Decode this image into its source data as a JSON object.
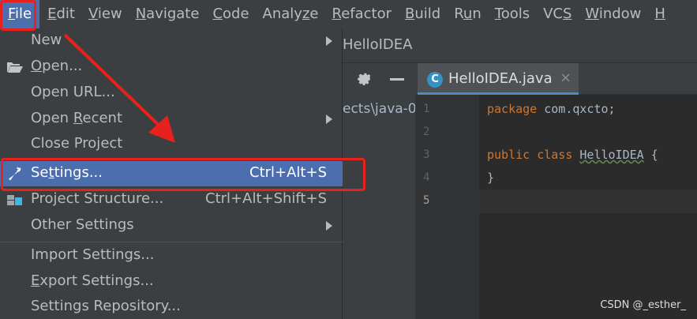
{
  "menubar": {
    "items": [
      {
        "pre": "",
        "u": "F",
        "post": "ile"
      },
      {
        "pre": "",
        "u": "E",
        "post": "dit"
      },
      {
        "pre": "",
        "u": "V",
        "post": "iew"
      },
      {
        "pre": "",
        "u": "N",
        "post": "avigate"
      },
      {
        "pre": "",
        "u": "C",
        "post": "ode"
      },
      {
        "pre": "Analy",
        "u": "z",
        "post": "e"
      },
      {
        "pre": "",
        "u": "R",
        "post": "efactor"
      },
      {
        "pre": "",
        "u": "B",
        "post": "uild"
      },
      {
        "pre": "R",
        "u": "u",
        "post": "n"
      },
      {
        "pre": "",
        "u": "T",
        "post": "ools"
      },
      {
        "pre": "VC",
        "u": "S",
        "post": ""
      },
      {
        "pre": "",
        "u": "W",
        "post": "indow"
      },
      {
        "pre": "",
        "u": "H",
        "post": ""
      }
    ]
  },
  "file_menu": {
    "items": [
      {
        "pre": "New",
        "u": "",
        "post": "",
        "shortcut": "",
        "submenu": true
      },
      {
        "pre": "",
        "u": "O",
        "post": "pen...",
        "shortcut": "",
        "submenu": false,
        "icon": "folder-open-icon"
      },
      {
        "pre": "Open URL...",
        "u": "",
        "post": "",
        "shortcut": "",
        "submenu": false
      },
      {
        "pre": "Open ",
        "u": "R",
        "post": "ecent",
        "shortcut": "",
        "submenu": true
      },
      {
        "pre": "Close Project",
        "u": "",
        "post": "",
        "shortcut": "",
        "submenu": false
      },
      {
        "pre": "Se",
        "u": "t",
        "post": "tings...",
        "shortcut": "Ctrl+Alt+S",
        "submenu": false,
        "icon": "wrench-icon"
      },
      {
        "pre": "Project Structure...",
        "u": "",
        "post": "",
        "shortcut": "Ctrl+Alt+Shift+S",
        "submenu": false,
        "icon": "project-structure-icon"
      },
      {
        "pre": "Other Settings",
        "u": "",
        "post": "",
        "shortcut": "",
        "submenu": true
      },
      {
        "pre": "Import Settings...",
        "u": "",
        "post": "",
        "shortcut": "",
        "submenu": false
      },
      {
        "pre": "",
        "u": "E",
        "post": "xport Settings...",
        "shortcut": "",
        "submenu": false
      },
      {
        "pre": "Settings Repository...",
        "u": "",
        "post": "",
        "shortcut": "",
        "submenu": false
      }
    ],
    "highlighted": "Settings..."
  },
  "navbar": {
    "project_title": "HelloIDEA"
  },
  "project_panel": {
    "path_fragment": "ects\\java-0"
  },
  "editor": {
    "tab_label": "HelloIDEA.java",
    "tab_icon_letter": "C",
    "tab_close": "×",
    "line_numbers": [
      "1",
      "2",
      "3",
      "4",
      "5"
    ],
    "lines": {
      "l1_kw": "package",
      "l1_rest": " com.qxcto;",
      "l3_kw": "public class",
      "l3_name": "HelloIDEA",
      "l3_rest": " {",
      "l4": "}"
    }
  },
  "watermark": "CSDN @_esther_",
  "colors": {
    "menubar_bg": "#3c3f41",
    "highlight": "#4b6eaf",
    "annotation_red": "#e8211c",
    "editor_bg": "#2b2b2b",
    "keyword": "#cc7832"
  }
}
